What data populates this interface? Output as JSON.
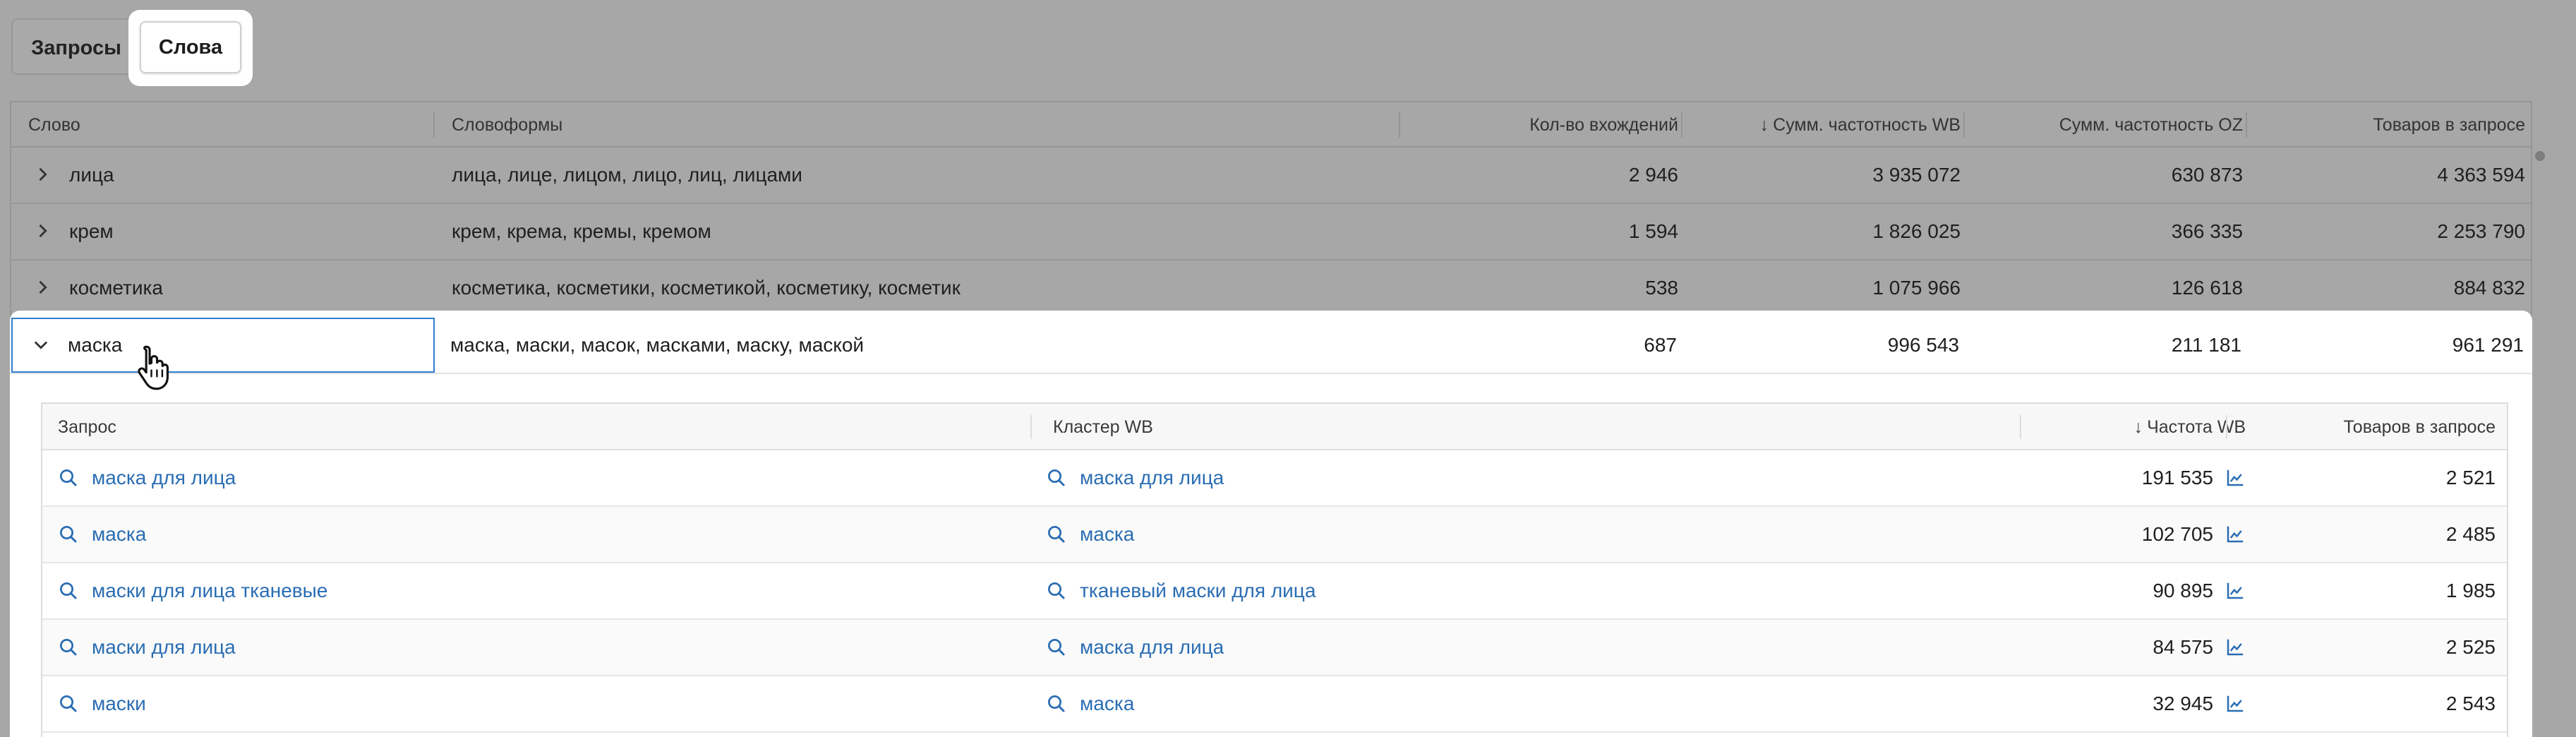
{
  "tabs": [
    {
      "label": "Запросы",
      "active": false
    },
    {
      "label": "Слова",
      "active": true
    }
  ],
  "words_table": {
    "columns": {
      "word": "Слово",
      "wordforms": "Словоформы",
      "occurrences": "Кол-во вхождений",
      "sum_freq_wb": "Сумм. частотность WB",
      "sum_freq_oz": "Сумм. частотность OZ",
      "goods_in_query": "Товаров в запросе"
    },
    "sort_arrow": "↓",
    "rows": [
      {
        "word": "лица",
        "wordforms": "лица, лице, лицом, лицо, лиц, лицами",
        "occurrences": "2 946",
        "sum_freq_wb": "3 935 072",
        "sum_freq_oz": "630 873",
        "goods_in_query": "4 363 594"
      },
      {
        "word": "крем",
        "wordforms": "крем, крема, кремы, кремом",
        "occurrences": "1 594",
        "sum_freq_wb": "1 826 025",
        "sum_freq_oz": "366 335",
        "goods_in_query": "2 253 790"
      },
      {
        "word": "косметика",
        "wordforms": "косметика, косметики, косметикой, косметику, косметик",
        "occurrences": "538",
        "sum_freq_wb": "1 075 966",
        "sum_freq_oz": "126 618",
        "goods_in_query": "884 832"
      }
    ],
    "expanded_row": {
      "word": "маска",
      "wordforms": "маска, маски, масок, масками, маску, маской",
      "occurrences": "687",
      "sum_freq_wb": "996 543",
      "sum_freq_oz": "211 181",
      "goods_in_query": "961 291"
    }
  },
  "queries_table": {
    "columns": {
      "query": "Запрос",
      "cluster": "Кластер WB",
      "freq_wb": "Частота WB",
      "goods_in_query": "Товаров в запросе"
    },
    "sort_arrow": "↓",
    "rows": [
      {
        "query": "маска для лица",
        "cluster": "маска для лица",
        "freq_wb": "191 535",
        "goods": "2 521"
      },
      {
        "query": "маска",
        "cluster": "маска",
        "freq_wb": "102 705",
        "goods": "2 485"
      },
      {
        "query": "маски для лица тканевые",
        "cluster": "тканевый маски для лица",
        "freq_wb": "90 895",
        "goods": "1 985"
      },
      {
        "query": "маски для лица",
        "cluster": "маска для лица",
        "freq_wb": "84 575",
        "goods": "2 525"
      },
      {
        "query": "маски",
        "cluster": "маска",
        "freq_wb": "32 945",
        "goods": "2 543"
      }
    ]
  },
  "icons": [
    "chevron-right-icon",
    "chevron-down-icon",
    "search-icon",
    "chart-icon",
    "hand-cursor-icon"
  ],
  "colors": {
    "link": "#2a6db3",
    "focus_border": "#2f7fd0",
    "dim_overlay": "#a7a7a7"
  }
}
